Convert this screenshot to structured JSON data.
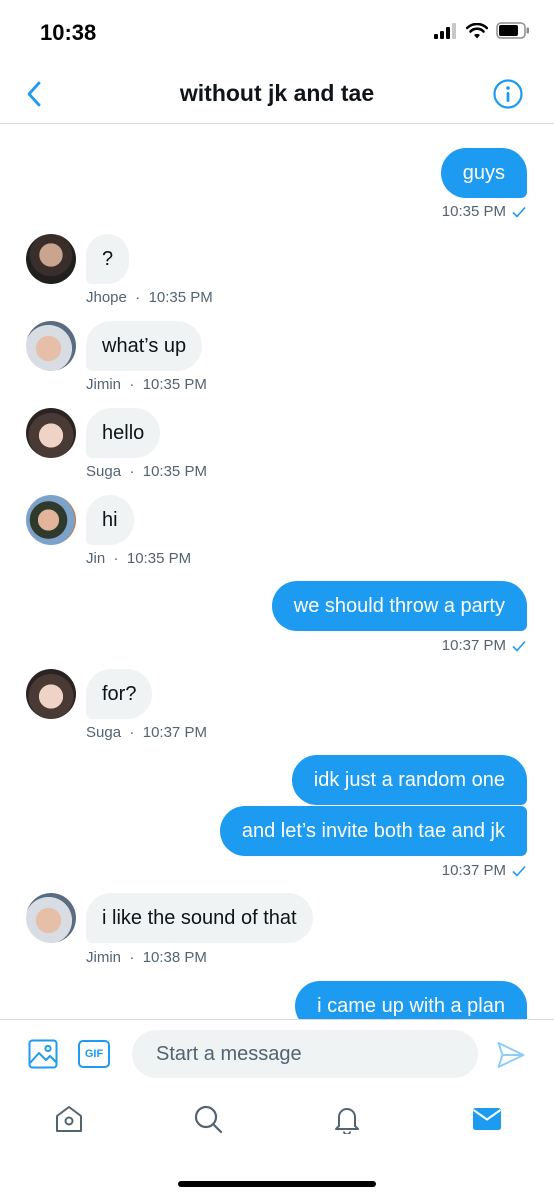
{
  "status_bar": {
    "time": "10:38"
  },
  "header": {
    "title": "without jk and tae"
  },
  "messages": [
    {
      "kind": "sent",
      "text": "guys",
      "time": "10:35 PM",
      "read": true
    },
    {
      "kind": "recv",
      "text": "?",
      "sender": "Jhope",
      "time": "10:35 PM",
      "avatar": "jhope-avatar"
    },
    {
      "kind": "recv",
      "text": "what’s up",
      "sender": "Jimin",
      "time": "10:35 PM",
      "avatar": "jimin-avatar"
    },
    {
      "kind": "recv",
      "text": "hello",
      "sender": "Suga",
      "time": "10:35 PM",
      "avatar": "suga-avatar"
    },
    {
      "kind": "recv",
      "text": "hi",
      "sender": "Jin",
      "time": "10:35 PM",
      "avatar": "jin-avatar"
    },
    {
      "kind": "sent",
      "text": "we should throw a party",
      "time": "10:37 PM",
      "read": true
    },
    {
      "kind": "recv",
      "text": "for?",
      "sender": "Suga",
      "time": "10:37 PM",
      "avatar": "suga-avatar"
    },
    {
      "kind": "sent",
      "text": "idk just a random one"
    },
    {
      "kind": "sent",
      "text": "and let’s invite both tae and jk",
      "time": "10:37 PM",
      "read": true
    },
    {
      "kind": "recv",
      "text": "i like the sound of that",
      "sender": "Jimin",
      "time": "10:38 PM",
      "avatar": "jimin-avatar"
    },
    {
      "kind": "sent",
      "text": "i came up with a plan"
    }
  ],
  "meta_separator": "·",
  "composer": {
    "placeholder": "Start a message",
    "gif_label": "GIF",
    "value": ""
  },
  "tabbar": {
    "items": [
      "home-icon",
      "search-icon",
      "notifications-icon",
      "messages-icon"
    ],
    "active": "messages-icon"
  },
  "colors": {
    "accent": "#1d9bf0",
    "received_bubble": "#eff3f4",
    "meta_text": "#536471"
  }
}
